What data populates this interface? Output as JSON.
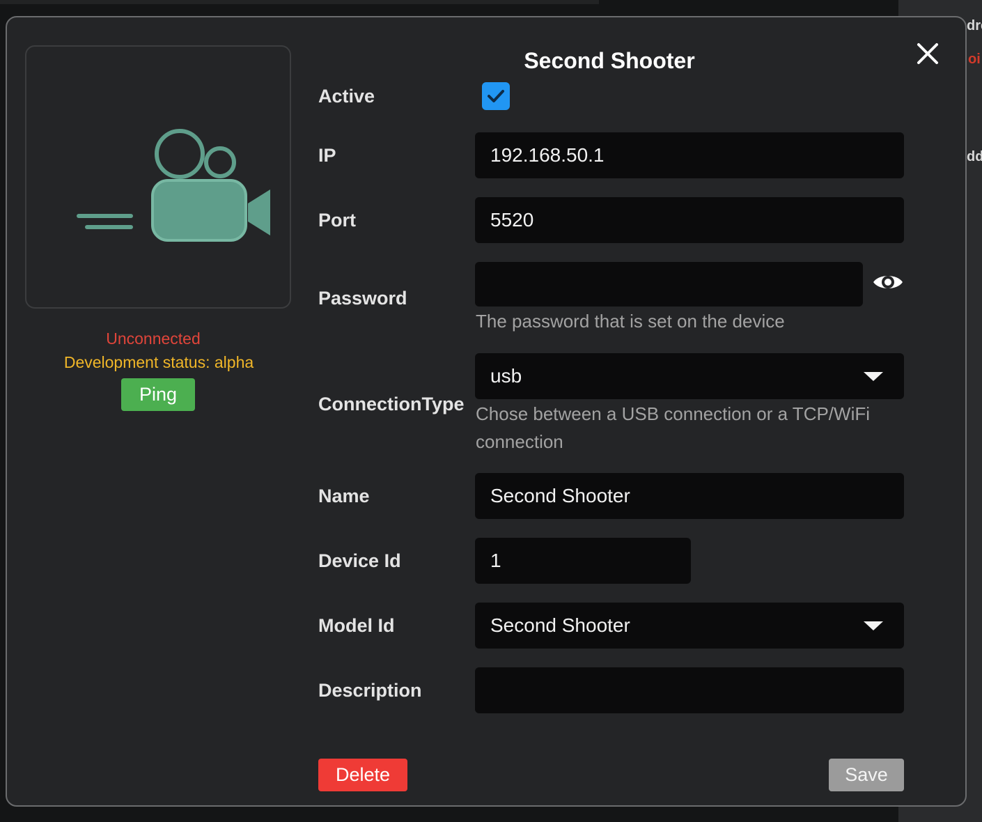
{
  "background": {
    "fragment_1": "dre",
    "fragment_2": "oi",
    "fragment_3": "dd"
  },
  "device": {
    "image_icon": "video-camera-icon",
    "connection_status": "Unconnected",
    "development_status": "Development status: alpha",
    "ping_label": "Ping"
  },
  "dialog": {
    "title": "Second Shooter",
    "close_icon": "close-icon"
  },
  "form": {
    "active": {
      "label": "Active",
      "checked": true
    },
    "ip": {
      "label": "IP",
      "value": "192.168.50.1"
    },
    "port": {
      "label": "Port",
      "value": "5520"
    },
    "password": {
      "label": "Password",
      "value": "",
      "hint": "The password that is set on the device",
      "toggle_icon": "eye-icon"
    },
    "connection_type": {
      "label": "ConnectionType",
      "value": "usb",
      "hint_line1": "Chose between a USB connection or a TCP/WiFi",
      "hint_line2": "connection"
    },
    "name": {
      "label": "Name",
      "value": "Second Shooter"
    },
    "device_id": {
      "label": "Device Id",
      "value": "1"
    },
    "model_id": {
      "label": "Model Id",
      "value": "Second Shooter"
    },
    "description": {
      "label": "Description",
      "value": ""
    }
  },
  "actions": {
    "delete_label": "Delete",
    "save_label": "Save"
  },
  "colors": {
    "accent_checkbox": "#2196f3",
    "ping_button": "#4caf50",
    "delete_button": "#ef3b36",
    "save_button": "#9b9b9b",
    "status_unconnected": "#e0453a",
    "status_development": "#f0b628",
    "camera_icon": "#5f9e8b"
  }
}
